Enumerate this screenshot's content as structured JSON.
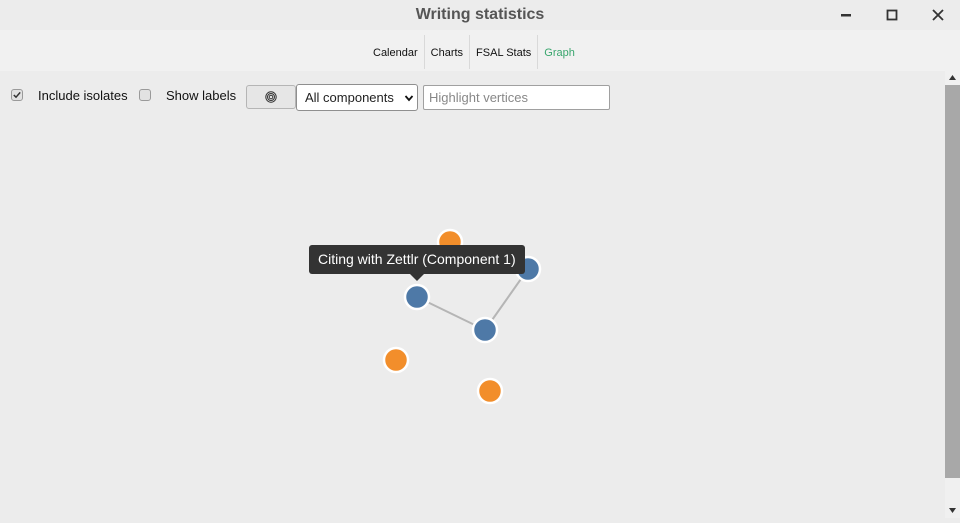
{
  "window": {
    "title": "Writing statistics"
  },
  "tabs": [
    {
      "label": "Calendar",
      "active": false
    },
    {
      "label": "Charts",
      "active": false
    },
    {
      "label": "FSAL Stats",
      "active": false
    },
    {
      "label": "Graph",
      "active": true
    }
  ],
  "toolbar": {
    "include_isolates": {
      "label": "Include isolates",
      "checked": true
    },
    "show_labels": {
      "label": "Show labels",
      "checked": false
    },
    "component_select": {
      "value": "All components"
    },
    "highlight_input": {
      "placeholder": "Highlight vertices",
      "value": ""
    }
  },
  "graph": {
    "tooltip": "Citing with Zettlr (Component 1)",
    "colors": {
      "connected": "#4e79a7",
      "isolate": "#f28e2b",
      "edge": "#b5b5b5"
    }
  },
  "icons": {
    "minimize": "minimize-icon",
    "maximize": "maximize-icon",
    "close": "close-icon",
    "spiral": "spiral-icon"
  }
}
